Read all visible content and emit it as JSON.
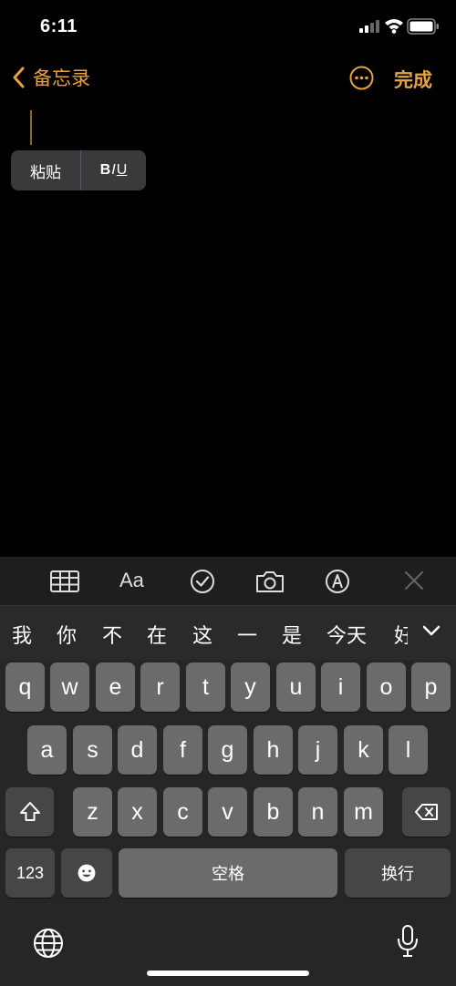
{
  "status_bar": {
    "time": "6:11"
  },
  "nav": {
    "back_label": "备忘录",
    "done_label": "完成"
  },
  "edit_menu": {
    "paste_label": "粘贴",
    "bold": "B",
    "italic": "I",
    "underline": "U"
  },
  "toolbar": {
    "format_label": "Aa"
  },
  "candidates": [
    "我",
    "你",
    "不",
    "在",
    "这",
    "一",
    "是",
    "今天",
    "好"
  ],
  "keyboard": {
    "row1": [
      "q",
      "w",
      "e",
      "r",
      "t",
      "y",
      "u",
      "i",
      "o",
      "p"
    ],
    "row2": [
      "a",
      "s",
      "d",
      "f",
      "g",
      "h",
      "j",
      "k",
      "l"
    ],
    "row3": [
      "z",
      "x",
      "c",
      "v",
      "b",
      "n",
      "m"
    ],
    "numbers_label": "123",
    "space_label": "空格",
    "return_label": "换行"
  },
  "colors": {
    "accent": "#e6a23c",
    "key": "#6b6b6b",
    "key_dark": "#464646",
    "background": "#000000"
  }
}
